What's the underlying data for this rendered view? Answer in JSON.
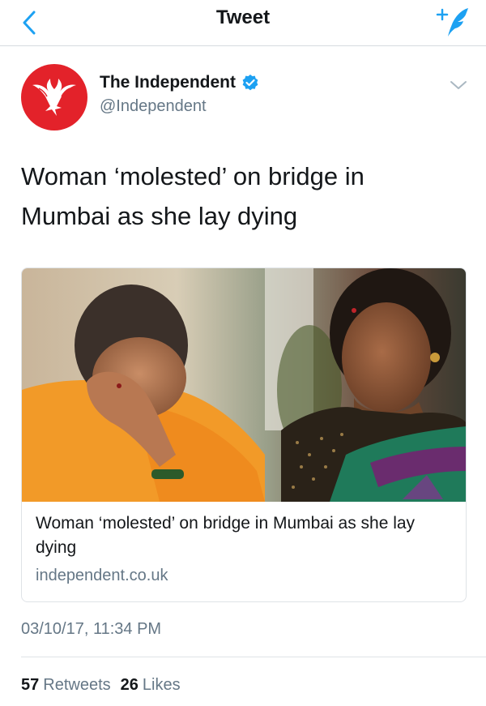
{
  "navbar": {
    "title": "Tweet",
    "back_icon": "chevron-left-icon",
    "compose_icon": "compose-tweet-icon",
    "accent_color": "#1da1f2"
  },
  "tweet": {
    "user": {
      "name": "The Independent",
      "handle": "@Independent",
      "verified": true,
      "avatar_color": "#e3222a"
    },
    "text": "Woman ‘molested’ on bridge in Mumbai as she lay dying",
    "card": {
      "title": "Woman ‘molested’ on bridge in Mumbai as she lay dying",
      "domain": "independent.co.uk"
    },
    "timestamp": "03/10/17, 11:34 PM",
    "stats": {
      "retweets_count": "57",
      "retweets_label": "Retweets",
      "likes_count": "26",
      "likes_label": "Likes"
    }
  }
}
